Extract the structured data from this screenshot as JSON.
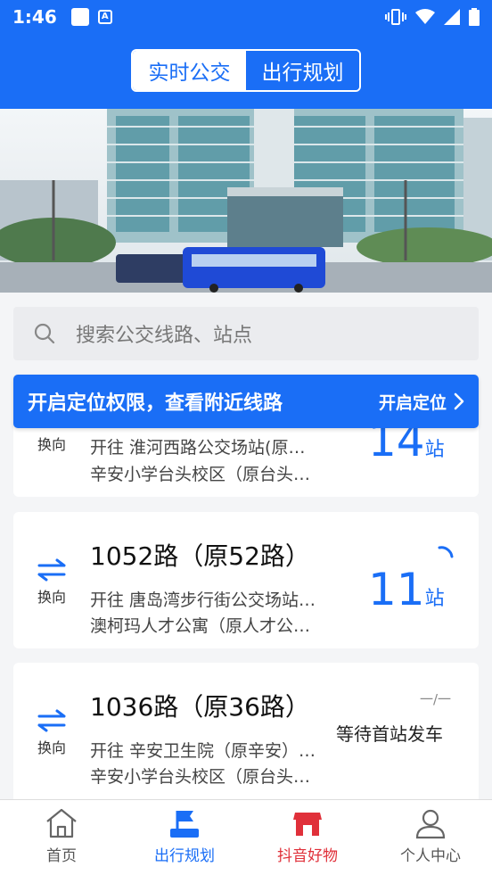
{
  "status_bar": {
    "time": "1:46"
  },
  "header": {
    "tab_realtime": "实时公交",
    "tab_plan": "出行规划"
  },
  "search": {
    "placeholder": "搜索公交线路、站点"
  },
  "location_banner": {
    "text": "开启定位权限，查看附近线路",
    "button": "开启定位"
  },
  "routes": [
    {
      "swap_label": "换向",
      "title": "",
      "dest1": "开往 淮河西路公交场站(原…",
      "dest2": "辛安小学台头校区（原台头…",
      "stops_num": "14",
      "stops_unit": "站",
      "status": ""
    },
    {
      "swap_label": "换向",
      "title": "1052路（原52路）",
      "dest1": "开往 唐岛湾步行街公交场站…",
      "dest2": "澳柯玛人才公寓（原人才公…",
      "stops_num": "11",
      "stops_unit": "站",
      "status": ""
    },
    {
      "swap_label": "换向",
      "title": "1036路（原36路）",
      "dest1": "开往 辛安卫生院（原辛安）…",
      "dest2": "辛安小学台头校区（原台头…",
      "stops_num": "",
      "stops_unit": "",
      "status": "等待首站发车",
      "dash": "一/一"
    }
  ],
  "tabbar": {
    "home": "首页",
    "plan": "出行规划",
    "shop": "抖音好物",
    "me": "个人中心"
  },
  "colors": {
    "primary": "#1a6ef6",
    "shop": "#e0303a"
  }
}
